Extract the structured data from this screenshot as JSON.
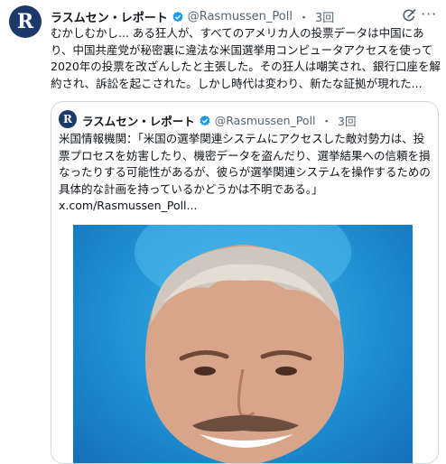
{
  "tweet": {
    "author_name": "ラスムセン・レポート",
    "author_handle": "@Rasmussen_Poll",
    "separator": "・",
    "time": "3回",
    "avatar_letter": "R",
    "text": "むかしむかし... ある狂人が、すべてのアメリカ人の投票データは中国にあり、中国共産党が秘密裏に違法な米国選挙用コンピュータアクセスを使って2020年の投票を改ざんしたと主張した。その狂人は嘲笑され、銀行口座を解約され、訴訟を起こされた。しかし時代は変わり、新たな証拠が現れた..."
  },
  "quoted": {
    "author_name": "ラスムセン・レポート",
    "author_handle": "@Rasmussen_Poll",
    "separator": "・",
    "time": "3回",
    "avatar_letter": "R",
    "text": "米国情報機関：「米国の選挙関連システムにアクセスした敵対勢力は、投票プロセスを妨害したり、機密データを盗んだり、選挙結果への信頼を損なったりする可能性があるが、彼らが選挙関連システムを操作するための具体的な計画を持っているかどうかは不明である。」",
    "link": "x.com/Rasmussen_Poll..."
  },
  "colors": {
    "accent": "#1d9bf0",
    "secondary_text": "#536471",
    "border": "#cfd9de",
    "photo_bg": "#2a9fdf"
  },
  "icons": [
    "verified-badge-icon",
    "grok-icon",
    "more-options-icon"
  ]
}
